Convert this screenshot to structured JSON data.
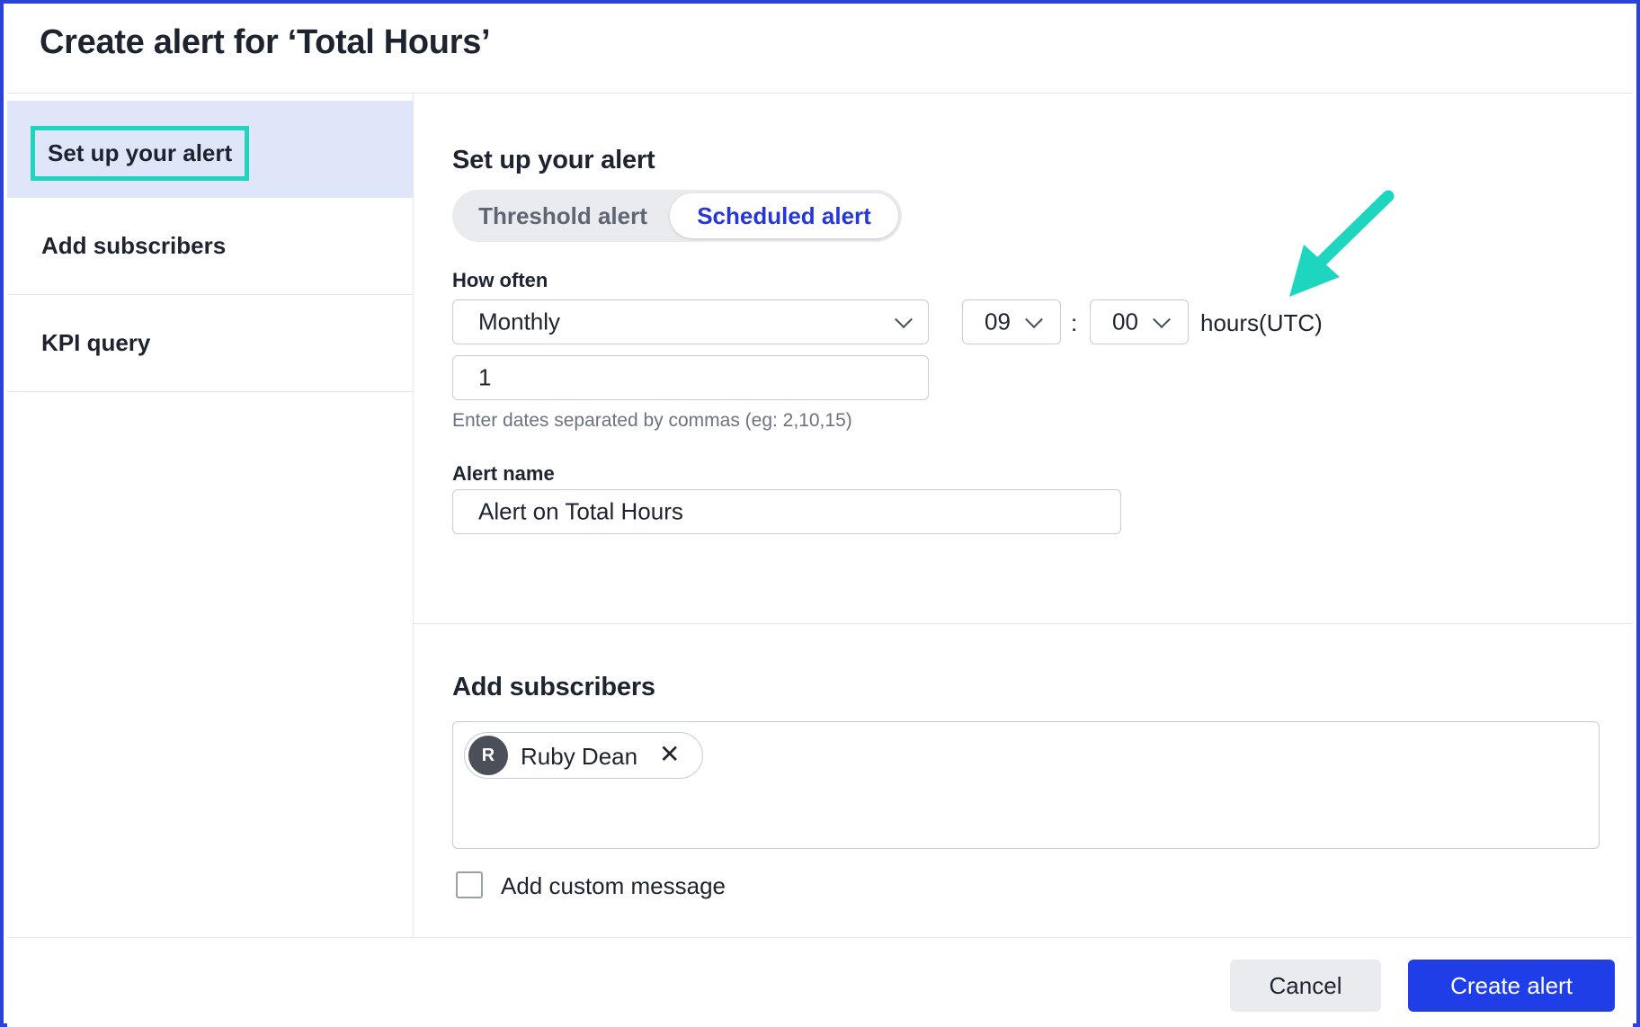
{
  "dialog": {
    "title": "Create alert for ‘Total Hours’"
  },
  "sidebar": {
    "items": [
      {
        "label": "Set up your alert",
        "active": true
      },
      {
        "label": "Add subscribers",
        "active": false
      },
      {
        "label": "KPI query",
        "active": false
      }
    ]
  },
  "setup": {
    "heading": "Set up your alert",
    "alert_type": {
      "options": [
        "Threshold alert",
        "Scheduled alert"
      ],
      "selected": "Scheduled alert"
    },
    "how_often": {
      "label": "How often",
      "frequency": "Monthly",
      "hour": "09",
      "minute": "00",
      "separator": ":",
      "units": "hours(UTC)",
      "dates_value": "1",
      "dates_hint": "Enter dates separated by commas (eg: 2,10,15)"
    },
    "alert_name": {
      "label": "Alert name",
      "value": "Alert on Total Hours"
    }
  },
  "subscribers": {
    "heading": "Add subscribers",
    "chips": [
      {
        "initial": "R",
        "name": "Ruby Dean",
        "remove": "✕"
      }
    ],
    "custom_message_label": "Add custom message",
    "custom_message_checked": false
  },
  "footer": {
    "cancel_label": "Cancel",
    "create_label": "Create alert"
  },
  "colors": {
    "accent": "#1f3ee8",
    "highlight": "#1ed6c0",
    "active_nav_bg": "#dfe6f9"
  }
}
